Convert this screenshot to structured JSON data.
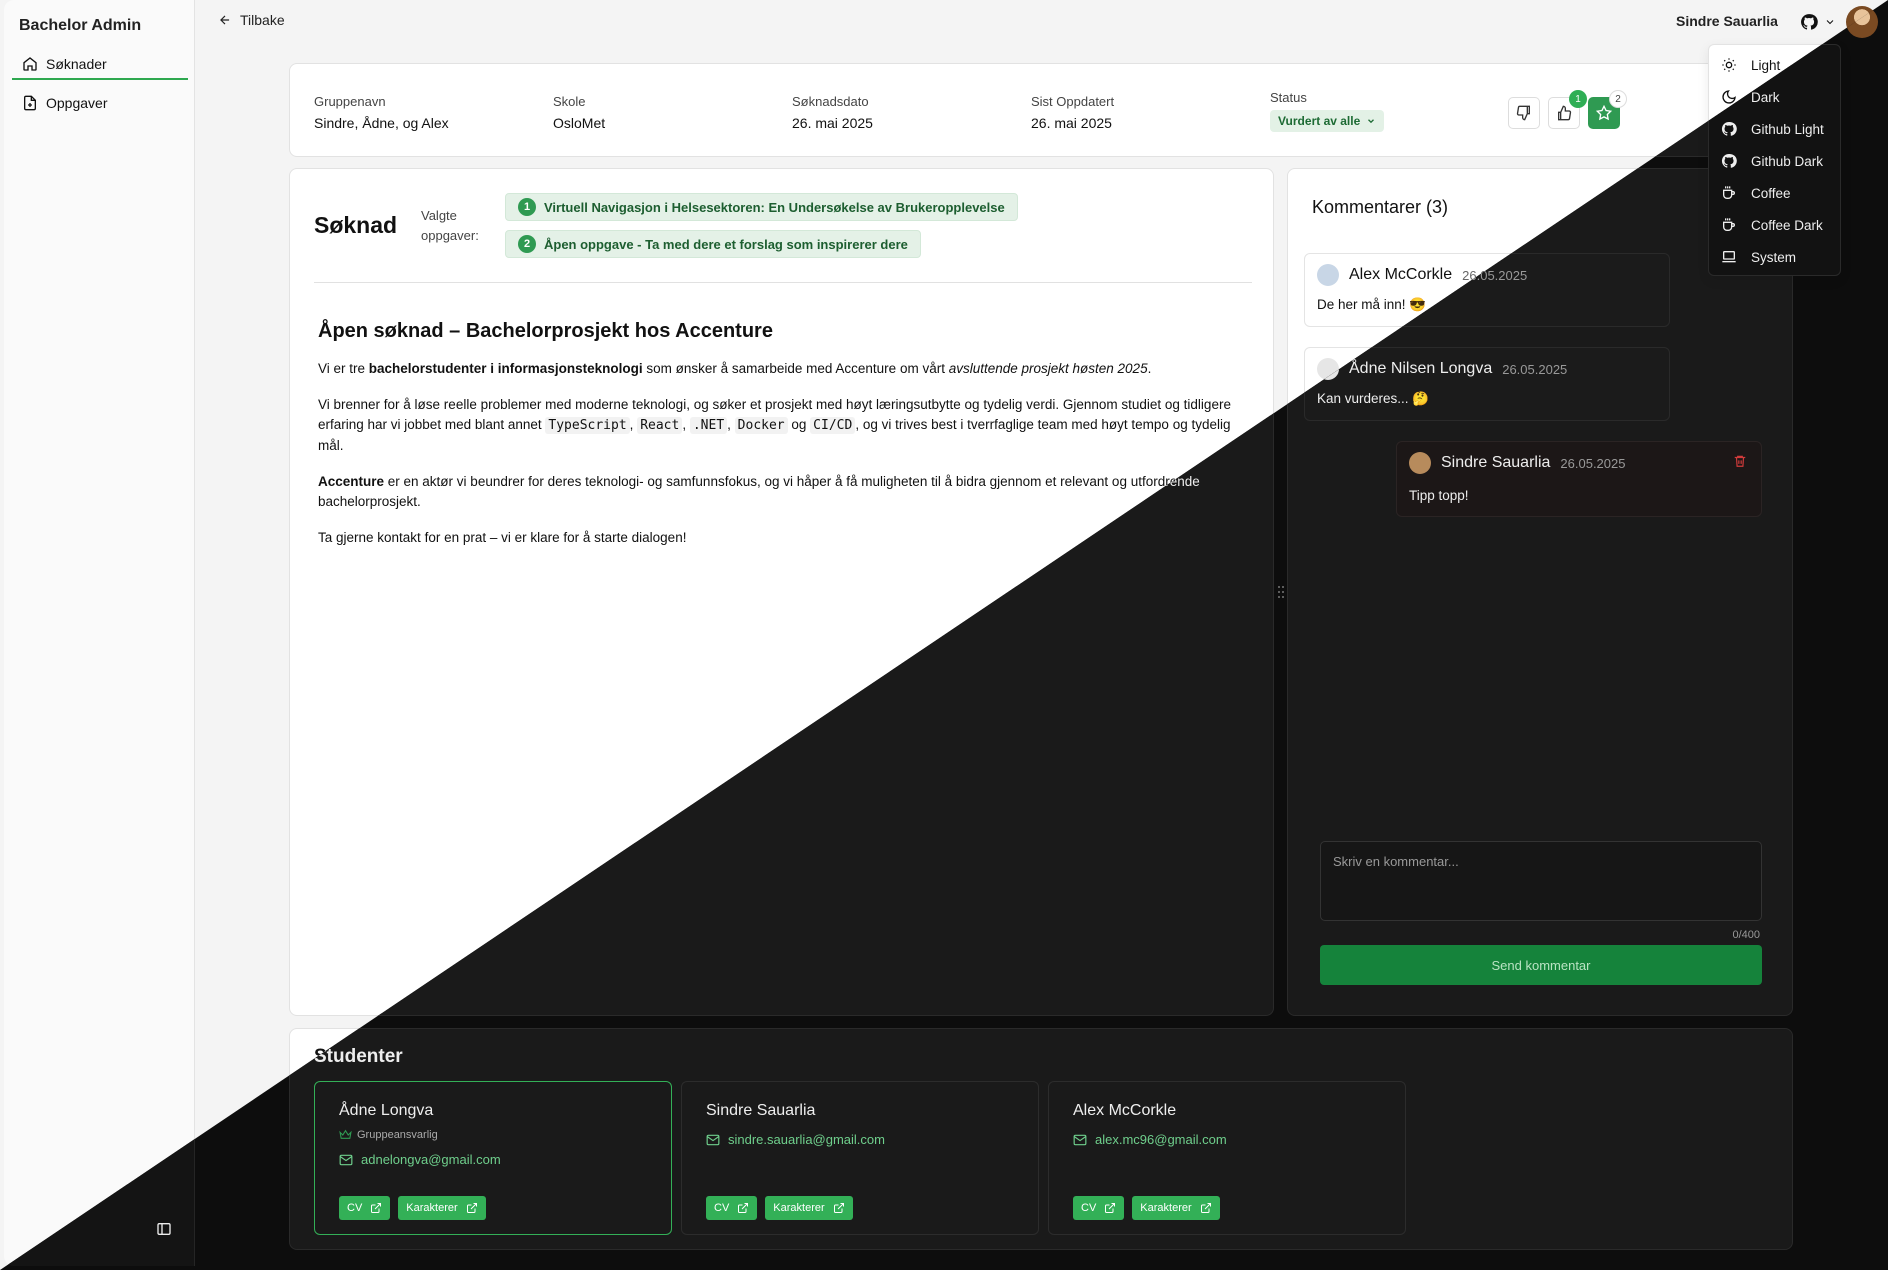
{
  "sidebar": {
    "brand": "Bachelor Admin",
    "items": [
      {
        "label": "Søknader",
        "icon": "home-icon"
      },
      {
        "label": "Oppgaver",
        "icon": "file-plus-icon"
      }
    ]
  },
  "header": {
    "back_label": "Tilbake",
    "user_name": "Sindre Sauarlia"
  },
  "theme_menu": {
    "items": [
      {
        "label": "Light",
        "icon": "sun-icon"
      },
      {
        "label": "Dark",
        "icon": "moon-icon"
      },
      {
        "label": "Github Light",
        "icon": "github-icon"
      },
      {
        "label": "Github Dark",
        "icon": "github-icon"
      },
      {
        "label": "Coffee",
        "icon": "coffee-icon"
      },
      {
        "label": "Coffee Dark",
        "icon": "coffee-icon"
      },
      {
        "label": "System",
        "icon": "laptop-icon"
      }
    ]
  },
  "info": {
    "group_label": "Gruppenavn",
    "group_value": "Sindre, Ådne, og Alex",
    "school_label": "Skole",
    "school_value": "OsloMet",
    "date_label": "Søknadsdato",
    "date_value": "26. mai 2025",
    "updated_label": "Sist Oppdatert",
    "updated_value": "26. mai 2025",
    "status_label": "Status",
    "status_value": "Vurdert av alle",
    "like_count": "1",
    "star_count": "2"
  },
  "application": {
    "title": "Søknad",
    "selected_label": "Valgte oppgaver:",
    "tasks": [
      {
        "num": "1",
        "label": "Virtuell Navigasjon i Helsesektoren: En Undersøkelse av Brukeropplevelse"
      },
      {
        "num": "2",
        "label": "Åpen oppgave - Ta med dere et forslag som inspirerer dere"
      }
    ],
    "doc": {
      "heading": "Åpen søknad – Bachelorprosjekt hos Accenture",
      "p1_a": "Vi er tre ",
      "p1_b": "bachelorstudenter i informasjonsteknologi",
      "p1_c": " som ønsker å samarbeide med Accenture om vårt ",
      "p1_d": "avsluttende prosjekt høsten 2025",
      "p1_e": ".",
      "p2_a": "Vi brenner for å løse reelle problemer med moderne teknologi, og søker et prosjekt med høyt læringsutbytte og tydelig verdi. Gjennom studiet og tidligere erfaring har vi jobbet med blant annet ",
      "code1": "TypeScript",
      "code2": "React",
      "code3": ".NET",
      "code4": "Docker",
      "og": " og ",
      "code5": "CI/CD",
      "p2_b": ", og vi trives best i tverrfaglige team med høyt tempo og tydelig mål.",
      "p3_a": "Accenture",
      "p3_b": " er en aktør vi beundrer for deres teknologi- og samfunnsfokus, og vi håper å få muligheten til å bidra gjennom et relevant og utfordrende bachelorprosjekt.",
      "p4": "Ta gjerne kontakt for en prat – vi er klare for å starte dialogen!"
    }
  },
  "comments": {
    "title": "Kommentarer (3)",
    "items": [
      {
        "name": "Alex McCorkle",
        "date": "26.05.2025",
        "text": "De her må inn! 😎"
      },
      {
        "name": "Ådne Nilsen Longva",
        "date": "26.05.2025",
        "text": "Kan vurderes... 🤔"
      },
      {
        "name": "Sindre Sauarlia",
        "date": "26.05.2025",
        "text": "Tipp topp!"
      }
    ],
    "placeholder": "Skriv en kommentar...",
    "counter": "0/400",
    "send_label": "Send kommentar"
  },
  "students": {
    "title": "Studenter",
    "items": [
      {
        "name": "Ådne Longva",
        "role": "Gruppeansvarlig",
        "email": "adnelongva@gmail.com"
      },
      {
        "name": "Sindre Sauarlia",
        "email": "sindre.sauarlia@gmail.com"
      },
      {
        "name": "Alex McCorkle",
        "email": "alex.mc96@gmail.com"
      }
    ],
    "cv_label": "CV",
    "grades_label": "Karakterer"
  },
  "colors": {
    "accent": "#2f9a52",
    "dark_bg": "#0d0d0d",
    "light_bg": "#f4f4f4"
  }
}
